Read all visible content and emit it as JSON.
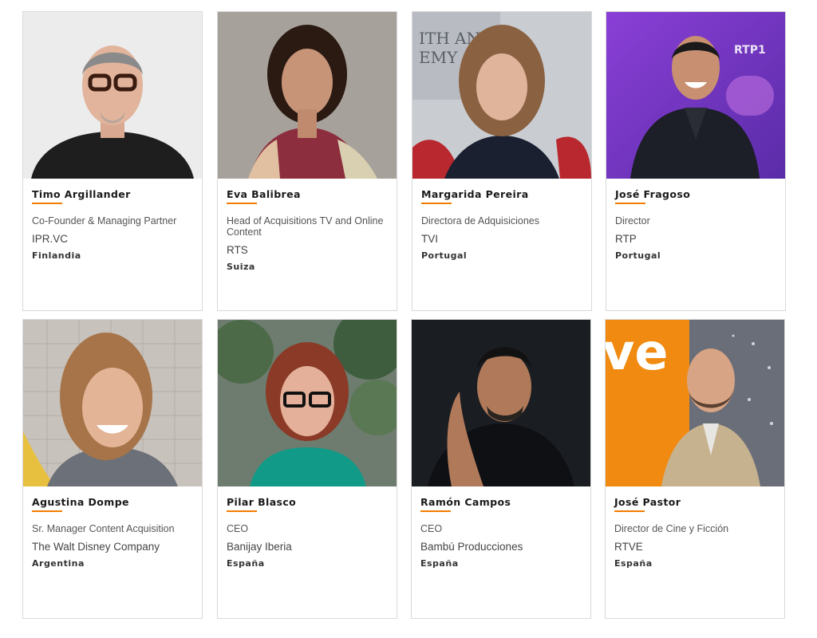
{
  "people": [
    {
      "name": "Timo Argillander",
      "role": "Co-Founder & Managing Partner",
      "company": "IPR.VC",
      "country": "Finlandia"
    },
    {
      "name": "Eva Balibrea",
      "role": "Head of Acquisitions TV and Online Content",
      "company": "RTS",
      "country": "Suiza"
    },
    {
      "name": "Margarida Pereira",
      "role": "Directora de Adquisiciones",
      "company": "TVI",
      "country": "Portugal"
    },
    {
      "name": "José Fragoso",
      "role": "Director",
      "company": "RTP",
      "country": "Portugal"
    },
    {
      "name": "Agustina Dompe",
      "role": "Sr. Manager Content Acquisition",
      "company": "The Walt Disney Company",
      "country": "Argentina"
    },
    {
      "name": "Pilar Blasco",
      "role": "CEO",
      "company": "Banijay Iberia",
      "country": "España"
    },
    {
      "name": "Ramón Campos",
      "role": "CEO",
      "company": "Bambú Producciones",
      "country": "España"
    },
    {
      "name": "José Pastor",
      "role": "Director de Cine y Ficción",
      "company": "RTVE",
      "country": "España"
    }
  ],
  "photo_backdrop_text": {
    "rtp_logo": "RTP1",
    "award_wall": "ITH ANN\nEMY AWA",
    "rtve_letters": "ve"
  },
  "accent_color": "#f07d00"
}
